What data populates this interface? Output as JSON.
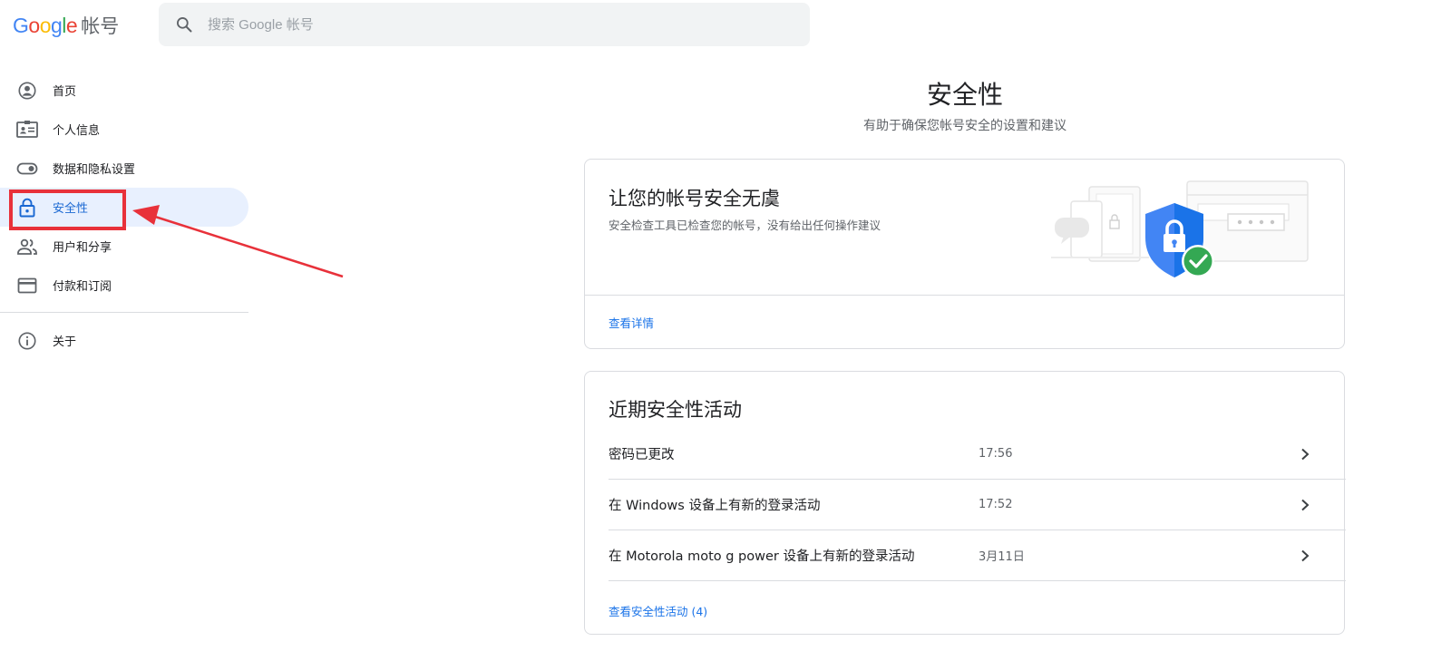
{
  "header": {
    "logo_letters": [
      "G",
      "o",
      "o",
      "g",
      "l",
      "e"
    ],
    "logo_colors": [
      "#4285f4",
      "#ea4335",
      "#fbbc05",
      "#4285f4",
      "#34a853",
      "#ea4335"
    ],
    "product_name": "帐号",
    "search_placeholder": "搜索 Google 帐号",
    "search_icon": "search-icon"
  },
  "sidebar": {
    "items": [
      {
        "label": "首页",
        "icon": "account-circle-icon"
      },
      {
        "label": "个人信息",
        "icon": "id-card-icon"
      },
      {
        "label": "数据和隐私设置",
        "icon": "toggle-icon"
      },
      {
        "label": "安全性",
        "icon": "lock-icon",
        "active": true
      },
      {
        "label": "用户和分享",
        "icon": "people-icon"
      },
      {
        "label": "付款和订阅",
        "icon": "credit-card-icon"
      }
    ],
    "footer_items": [
      {
        "label": "关于",
        "icon": "info-icon"
      }
    ],
    "active_color": "#1967d2",
    "active_bg": "#e8f0fe"
  },
  "main": {
    "title": "安全性",
    "subtitle": "有助于确保您帐号安全的设置和建议",
    "security_checkup": {
      "title": "让您的帐号安全无虞",
      "description": "安全检查工具已检查您的帐号，没有给出任何操作建议",
      "link": "查看详情",
      "illustration": "shield-check-illustration"
    },
    "recent_activity": {
      "title": "近期安全性活动",
      "rows": [
        {
          "label": "密码已更改",
          "time": "17:56"
        },
        {
          "label": "在 Windows 设备上有新的登录活动",
          "time": "17:52"
        },
        {
          "label": "在 Motorola moto g power 设备上有新的登录活动",
          "time": "3月11日"
        }
      ],
      "link": "查看安全性活动 (4)"
    }
  },
  "annotation": {
    "color": "#e8313a"
  },
  "colors": {
    "link": "#1a73e8",
    "border": "#dadce0",
    "text_secondary": "#5f6368"
  }
}
